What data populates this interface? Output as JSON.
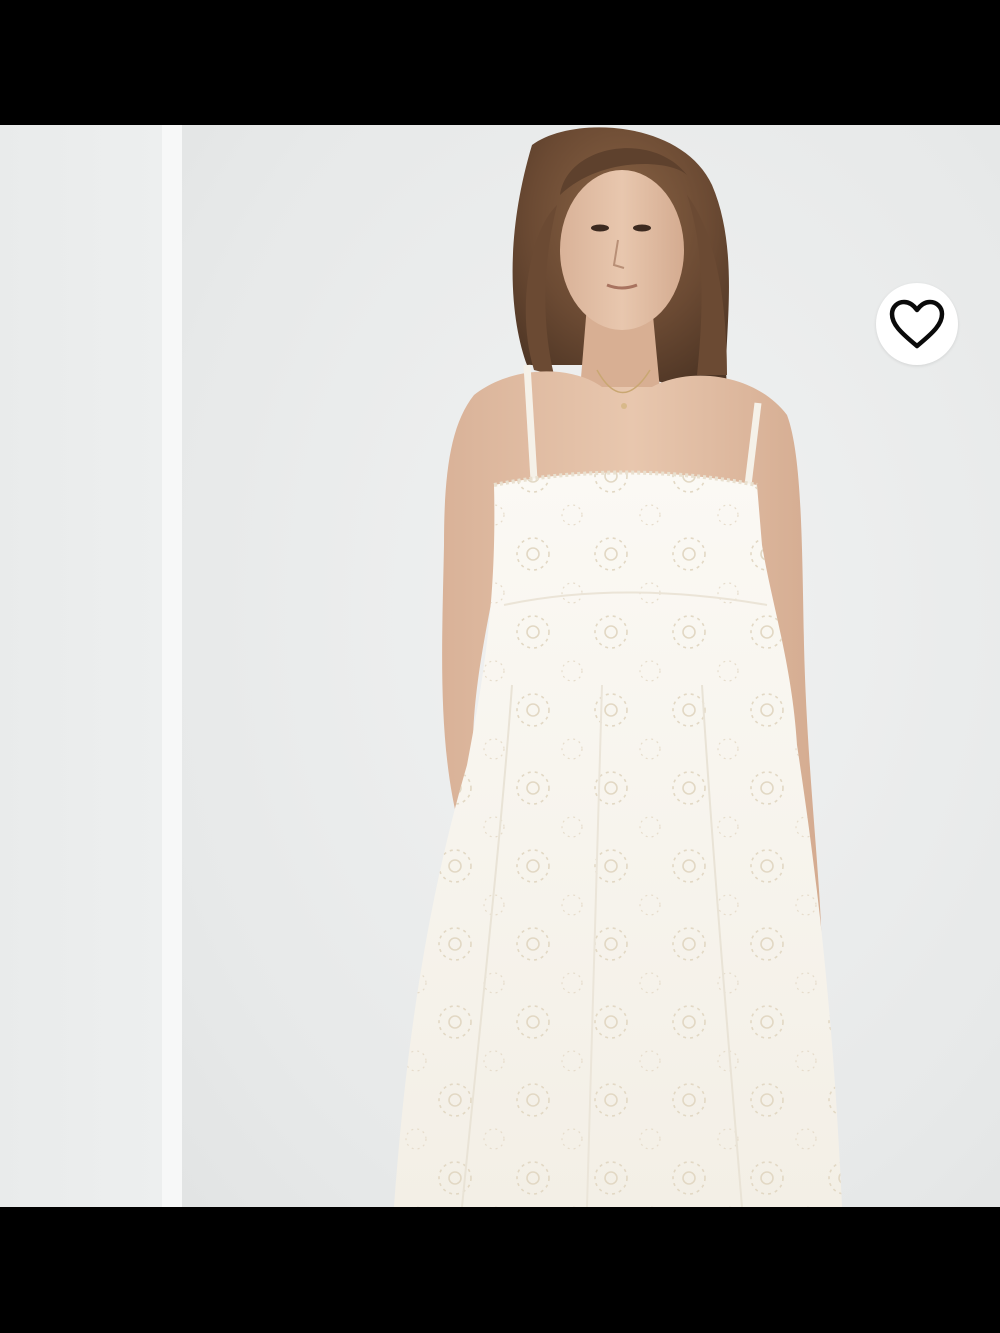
{
  "viewer": {
    "images": [
      {
        "name": "previous-image-partial",
        "alt": ""
      },
      {
        "name": "model-white-eyelet-dress",
        "alt": ""
      }
    ]
  },
  "wishlist": {
    "icon": "heart-outline-icon",
    "state": "not-saved"
  },
  "colors": {
    "background": "#000000",
    "photo_bg": "#eceeee",
    "dress": "#f8f5ee",
    "wishlist_button": "#ffffff"
  }
}
